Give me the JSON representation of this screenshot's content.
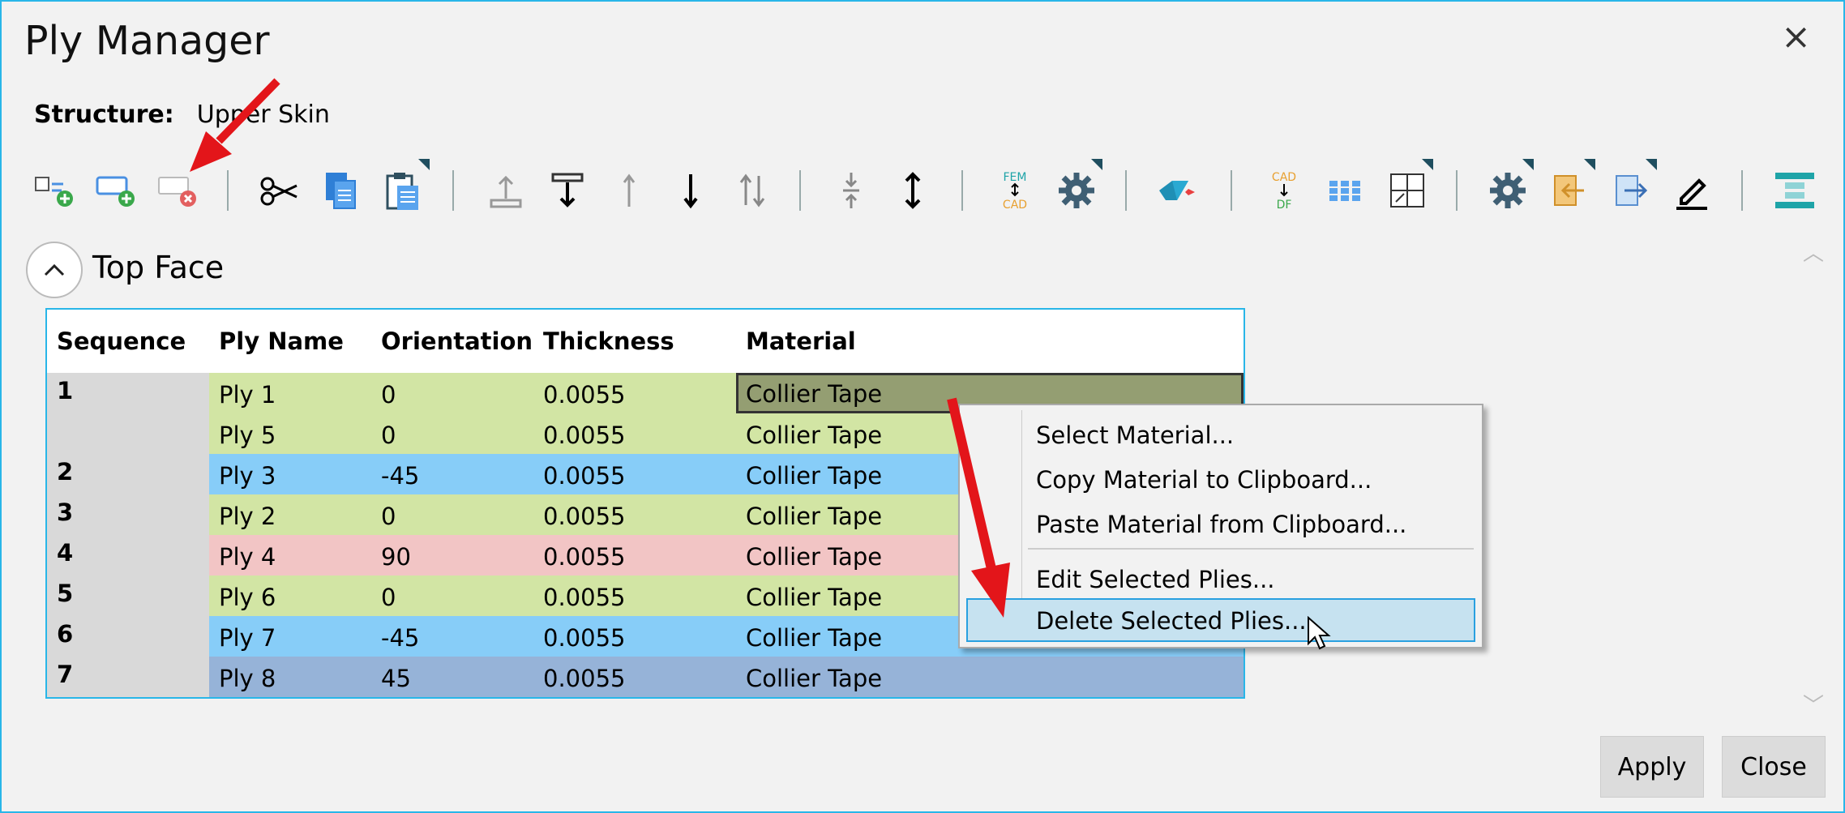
{
  "window": {
    "title": "Ply Manager",
    "close_glyph": "×"
  },
  "structure": {
    "label": "Structure:",
    "value": "Upper Skin"
  },
  "section": {
    "title": "Top Face"
  },
  "toolbar": {
    "fem_cad_top": "FEM",
    "fem_cad_bottom": "CAD",
    "cad_df_top": "CAD",
    "cad_df_bottom": "DF"
  },
  "table": {
    "headers": [
      "Sequence",
      "Ply Name",
      "Orientation",
      "Thickness",
      "Material"
    ],
    "rows": [
      {
        "seq": "1",
        "name": "Ply 1",
        "orientation": "0",
        "thickness": "0.0055",
        "material": "Collier Tape"
      },
      {
        "seq": "",
        "name": "Ply 5",
        "orientation": "0",
        "thickness": "0.0055",
        "material": "Collier Tape"
      },
      {
        "seq": "2",
        "name": "Ply 3",
        "orientation": "-45",
        "thickness": "0.0055",
        "material": "Collier Tape"
      },
      {
        "seq": "3",
        "name": "Ply 2",
        "orientation": "0",
        "thickness": "0.0055",
        "material": "Collier Tape"
      },
      {
        "seq": "4",
        "name": "Ply 4",
        "orientation": "90",
        "thickness": "0.0055",
        "material": "Collier Tape"
      },
      {
        "seq": "5",
        "name": "Ply 6",
        "orientation": "0",
        "thickness": "0.0055",
        "material": "Collier Tape"
      },
      {
        "seq": "6",
        "name": "Ply 7",
        "orientation": "-45",
        "thickness": "0.0055",
        "material": "Collier Tape"
      },
      {
        "seq": "7",
        "name": "Ply 8",
        "orientation": "45",
        "thickness": "0.0055",
        "material": "Collier Tape"
      }
    ]
  },
  "colors": {
    "orient_0": "#d2e5a4",
    "orient_neg45": "#87cdf8",
    "orient_90": "#f2c5c5",
    "orient_45": "#96b3d8",
    "selected_cell": "#949e72",
    "accent": "#29b6e8",
    "annotation_arrow": "#e3151a"
  },
  "context_menu": {
    "items": [
      "Select Material...",
      "Copy Material to Clipboard...",
      "Paste Material from Clipboard...",
      "Edit Selected Plies...",
      "Delete Selected Plies..."
    ],
    "highlighted": "Delete Selected Plies..."
  },
  "buttons": {
    "apply": "Apply",
    "close": "Close"
  }
}
